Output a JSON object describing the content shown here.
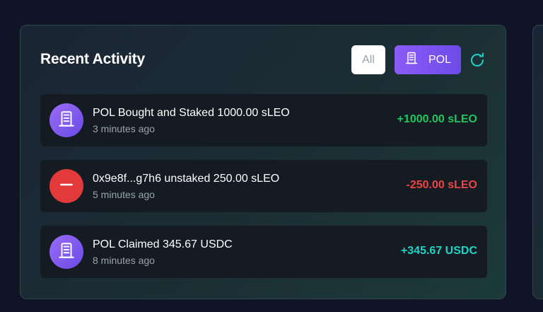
{
  "activity": {
    "title": "Recent Activity",
    "filters": [
      {
        "label": "All",
        "icon": "building-icon"
      },
      {
        "label": "POL",
        "icon": "building-icon"
      }
    ],
    "refresh_icon": "refresh-icon",
    "items": [
      {
        "text": "POL Bought and Staked 1000.00 sLEO",
        "time": "3 minutes ago",
        "amount": "+1000.00 sLEO",
        "icon": "building-icon",
        "amount_color": "#22c55e"
      },
      {
        "text": "0x9e8f...g7h6 unstaked 250.00 sLEO",
        "time": "5 minutes ago",
        "amount": "-250.00 sLEO",
        "icon": "minus-icon",
        "amount_color": "#ef4444"
      },
      {
        "text": "POL Claimed 345.67 USDC",
        "time": "8 minutes ago",
        "amount": "+345.67 USDC",
        "icon": "building-icon",
        "amount_color": "#22d3c5"
      }
    ]
  },
  "colors": {
    "accent_purple": "#8b5cf6",
    "refresh_teal": "#22d3c5"
  }
}
